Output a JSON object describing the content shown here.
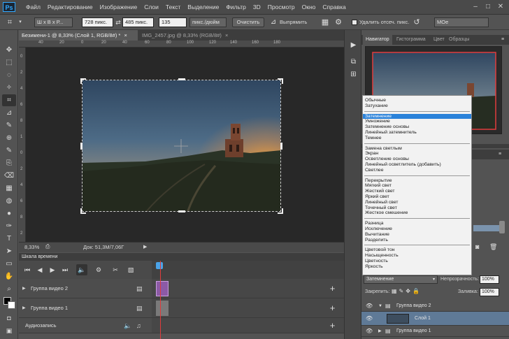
{
  "app": {
    "logo": "Ps",
    "menu": [
      "Файл",
      "Редактирование",
      "Изображение",
      "Слои",
      "Текст",
      "Выделение",
      "Фильтр",
      "3D",
      "Просмотр",
      "Окно",
      "Справка"
    ],
    "window_controls": [
      "–",
      "□",
      "✕"
    ]
  },
  "options_bar": {
    "ratio": "Ш x В x Р...",
    "width": "728 пикс.",
    "swap": "⇄",
    "height": "485 пикс.",
    "resolution": "135",
    "resolution_unit": "пикс./дюйм",
    "clear_button": "Очистить",
    "straighten_button": "Выпрямить",
    "delete_cropped_label": "Удалить отсеч. пикс.",
    "workspace": "МОе"
  },
  "tools": [
    "✥",
    "⬚",
    "◌",
    "✧",
    "⌗",
    "⊿",
    "✎",
    "⊕",
    "✎",
    "⎘",
    "⌫",
    "▦",
    "◍",
    "●",
    "✑",
    "T",
    "➤",
    "▭",
    "✋",
    "⌕"
  ],
  "documents": {
    "active_tab": "Безимени-1 @ 8,33% (Слой 1, RGB/8#) *",
    "inactive_tab": "IMG_2457.jpg @ 8,33% (RGB/8#)",
    "close": "×"
  },
  "ruler": {
    "h_ticks": [
      "40",
      "20",
      "0",
      "20",
      "40",
      "60",
      "80",
      "100",
      "120",
      "140",
      "160",
      "180"
    ],
    "v_ticks": [
      "0",
      "2",
      "4",
      "6",
      "8",
      "1",
      "0",
      "2",
      "4",
      "6",
      "8",
      "2"
    ]
  },
  "status": {
    "zoom": "8,33%",
    "doc_size": "Док: 51,3M/7,06Г"
  },
  "timeline": {
    "title": "Шкала времени",
    "tracks": [
      {
        "label": "Группа видео 2"
      },
      {
        "label": "Группа видео 1"
      },
      {
        "label": "Аудиозапись"
      }
    ],
    "add": "+"
  },
  "panels": {
    "tabs": [
      "Навигатор",
      "Гистограмма",
      "Цвет",
      "Образцы"
    ],
    "menu": "≡"
  },
  "blend_modes": {
    "groups": [
      [
        "Обычные",
        "Затухание"
      ],
      [
        "Затемнение",
        "Умножение",
        "Затемнение основы",
        "Линейный затемнитель",
        "Темнее"
      ],
      [
        "Замена светлым",
        "Экран",
        "Осветление основы",
        "Линейный осветлитель (добавить)",
        "Светлее"
      ],
      [
        "Перекрытие",
        "Мягкий свет",
        "Жесткий свет",
        "Яркий свет",
        "Линейный свет",
        "Точечный свет",
        "Жесткое смешение"
      ],
      [
        "Разница",
        "Исключение",
        "Вычитание",
        "Разделить"
      ],
      [
        "Цветовой тон",
        "Насыщенность",
        "Цветность",
        "Яркость"
      ]
    ],
    "selected": "Затемнение"
  },
  "layers": {
    "blend_value": "Затемнение",
    "opacity_label": "Непрозрачность:",
    "opacity_value": "100%",
    "lock_label": "Закрепить:",
    "fill_label": "Заливка:",
    "fill_value": "100%",
    "items": [
      {
        "name": "Группа видео 2"
      },
      {
        "name": "Слой 1"
      },
      {
        "name": "Группа видео 1"
      }
    ]
  }
}
